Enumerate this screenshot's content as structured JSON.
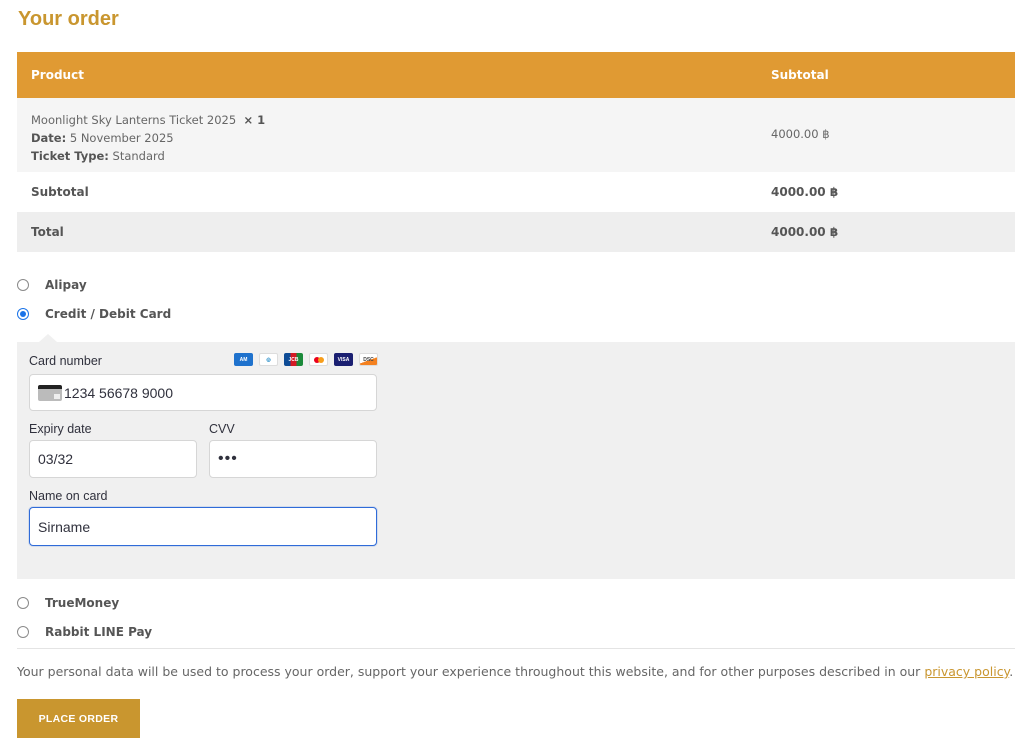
{
  "title": "Your order",
  "table": {
    "col_product": "Product",
    "col_subtotal": "Subtotal",
    "item": {
      "name": "Moonlight Sky Lanterns Ticket 2025",
      "qty": "× 1",
      "date_label": "Date:",
      "date_value": "5 November 2025",
      "type_label": "Ticket Type:",
      "type_value": "Standard",
      "subtotal": "4000.00 ฿"
    },
    "subtotal_label": "Subtotal",
    "subtotal_value": "4000.00 ฿",
    "total_label": "Total",
    "total_value": "4000.00 ฿"
  },
  "payment_methods": {
    "alipay": "Alipay",
    "card": "Credit / Debit Card",
    "truemoney": "TrueMoney",
    "rabbit": "Rabbit LINE Pay",
    "selected": "card"
  },
  "card_form": {
    "card_number_label": "Card number",
    "card_number_value": "1234 56678 9000",
    "expiry_label": "Expiry date",
    "expiry_value": "03/32",
    "cvv_label": "CVV",
    "cvv_value": "•••",
    "name_label": "Name on card",
    "name_value": "Sirname",
    "brands": [
      "amex-icon",
      "diners-icon",
      "jcb-icon",
      "mastercard-icon",
      "visa-icon",
      "discover-icon"
    ]
  },
  "privacy": {
    "text": "Your personal data will be used to process your order, support your experience throughout this website, and for other purposes described in our",
    "link": "privacy policy",
    "end": "."
  },
  "place_order": "PLACE ORDER",
  "colors": {
    "accent": "#e09a33",
    "button": "#c9962f",
    "radio_selected": "#1a73e8"
  }
}
